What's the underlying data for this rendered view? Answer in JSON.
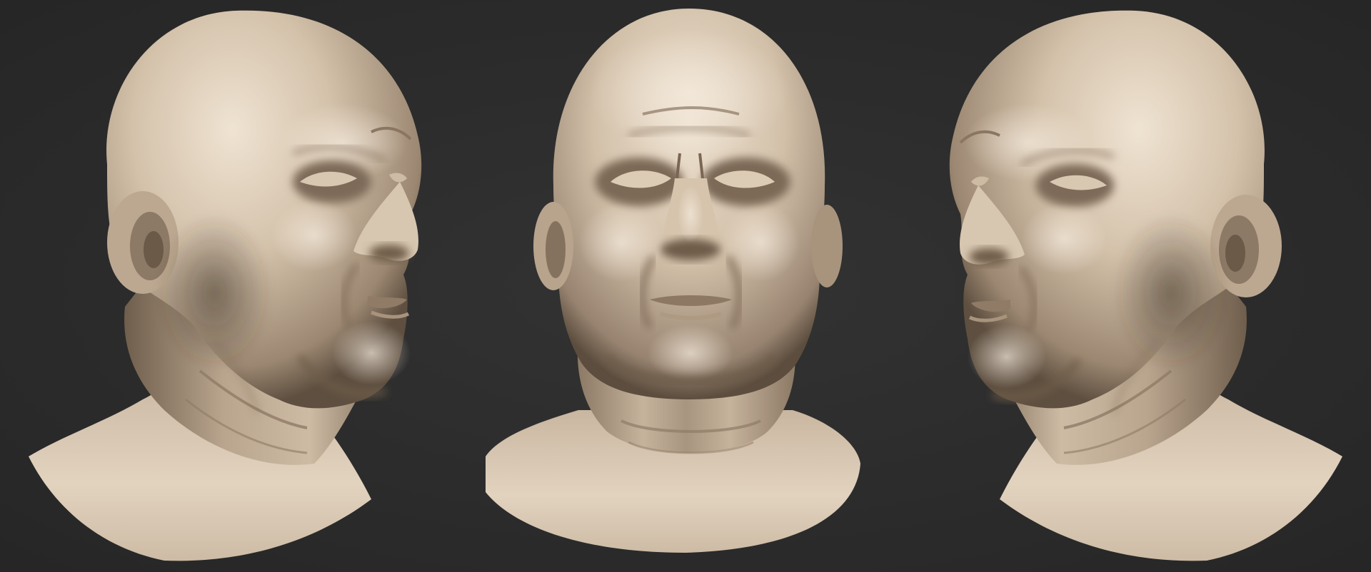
{
  "scene": {
    "background_color": "#2b2b2b",
    "background_center_color": "#333333",
    "material_light": "#e6d7c3",
    "material_mid": "#c4b19a",
    "material_dark": "#7d6b58",
    "material_shadow": "#4a3d31",
    "views": [
      {
        "view": "three-quarter-right"
      },
      {
        "view": "front"
      },
      {
        "view": "three-quarter-left"
      }
    ]
  }
}
